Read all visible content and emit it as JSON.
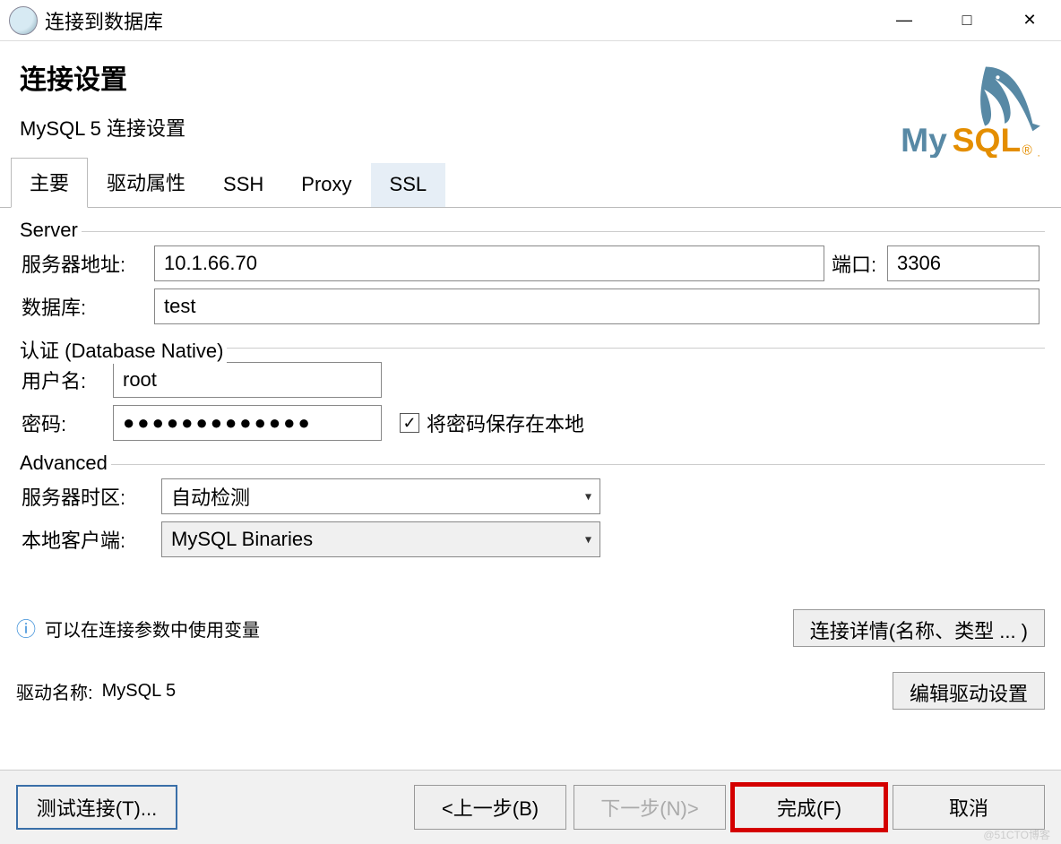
{
  "window": {
    "title": "连接到数据库",
    "min": "—",
    "max": "□",
    "close": "✕"
  },
  "header": {
    "title": "连接设置",
    "subtitle": "MySQL 5 连接设置"
  },
  "tabs": [
    {
      "label": "主要",
      "active": true
    },
    {
      "label": "驱动属性"
    },
    {
      "label": "SSH"
    },
    {
      "label": "Proxy"
    },
    {
      "label": "SSL",
      "highlight": true
    }
  ],
  "server": {
    "group_title": "Server",
    "host_label": "服务器地址:",
    "host_value": "10.1.66.70",
    "port_label": "端口:",
    "port_value": "3306",
    "db_label": "数据库:",
    "db_value": "test"
  },
  "auth": {
    "group_title": "认证 (Database Native)",
    "user_label": "用户名:",
    "user_value": "root",
    "pwd_label": "密码:",
    "pwd_value": "●●●●●●●●●●●●●",
    "save_checkbox": "将密码保存在本地",
    "save_checked": true
  },
  "advanced": {
    "group_title": "Advanced",
    "tz_label": "服务器时区:",
    "tz_value": "自动检测",
    "client_label": "本地客户端:",
    "client_value": "MySQL Binaries"
  },
  "info": {
    "hint": "可以在连接参数中使用变量",
    "details_button": "连接详情(名称、类型 ... )"
  },
  "driver": {
    "label": "驱动名称:",
    "value": "MySQL 5",
    "edit_button": "编辑驱动设置"
  },
  "buttons": {
    "test": "测试连接(T)...",
    "back": "<上一步(B)",
    "next": "下一步(N)>",
    "finish": "完成(F)",
    "cancel": "取消"
  },
  "watermark": "@51CTO博客"
}
